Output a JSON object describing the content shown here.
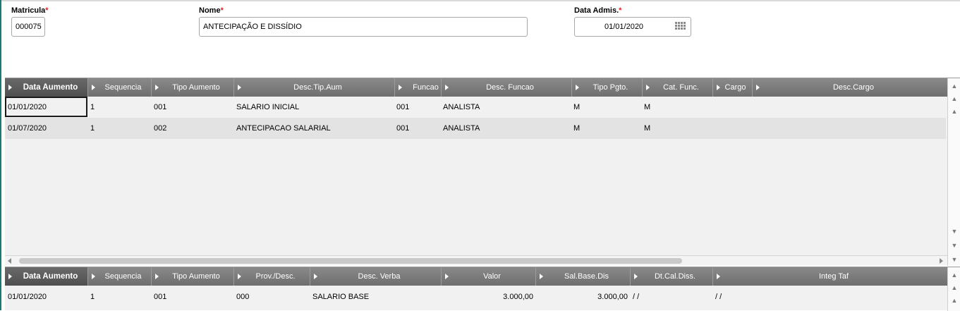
{
  "form": {
    "matricula": {
      "label": "Matricula",
      "required_mark": "*",
      "value": "000075"
    },
    "nome": {
      "label": "Nome",
      "required_mark": "*",
      "value": "ANTECIPAÇÃO E DISSÍDIO"
    },
    "data_admis": {
      "label": "Data Admis.",
      "required_mark": "*",
      "value": "01/01/2020",
      "icon": "calendar-icon"
    }
  },
  "grid1": {
    "columns": [
      "Data Aumento",
      "Sequencia",
      "Tipo Aumento",
      "Desc.Tip.Aum",
      "Funcao",
      "Desc. Funcao",
      "Tipo Pgto.",
      "Cat. Func.",
      "Cargo",
      "Desc.Cargo"
    ],
    "rows": [
      [
        "01/01/2020",
        "1",
        "001",
        "SALARIO INICIAL",
        "001",
        "ANALISTA",
        "M",
        "M",
        "",
        ""
      ],
      [
        "01/07/2020",
        "1",
        "002",
        "ANTECIPACAO SALARIAL",
        "001",
        "ANALISTA",
        "M",
        "M",
        "",
        ""
      ]
    ]
  },
  "grid2": {
    "columns": [
      "Data Aumento",
      "Sequencia",
      "Tipo Aumento",
      "Prov./Desc.",
      "Desc. Verba",
      "Valor",
      "Sal.Base.Dis",
      "Dt.Cal.Diss.",
      "Integ Taf"
    ],
    "rows": [
      [
        "01/01/2020",
        "1",
        "001",
        "000",
        "SALARIO BASE",
        "3.000,00",
        "3.000,00",
        " / /",
        " / /"
      ]
    ]
  },
  "colors": {
    "header_bg": "#7a7a7a",
    "header_first_bg": "#555555",
    "row_alt": "#e3e3e3",
    "required": "#e02020"
  }
}
